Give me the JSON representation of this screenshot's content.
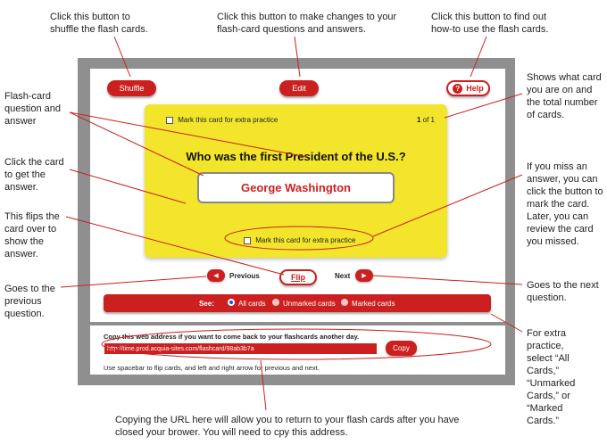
{
  "annotations": {
    "shuffle": "Click this button to shuffle the flash cards.",
    "edit": "Click this button to make changes to your flash-card questions and answers.",
    "help": "Click this button to find out how-to use the flash cards.",
    "card_count": "Shows what card you are on and the total number of cards.",
    "qa": "Flash-card question and answer",
    "click_card": "Click the card to get the answer.",
    "flip": "This flips the card over to show the answer.",
    "previous": "Goes to the previous question.",
    "mark": "If you miss an answer, you can click the button to mark the card. Later, you can review the card you missed.",
    "next": "Goes to the next question.",
    "filter": "For extra practice, select “All Cards,” “Unmarked Cards,” or “Marked Cards.”",
    "copy_url": "Copying the URL here will allow you to return to your flash cards after you have closed your brower. You will need to cpy this address."
  },
  "toolbar": {
    "shuffle_label": "Shuffle",
    "edit_label": "Edit",
    "help_label": "Help"
  },
  "card": {
    "mark_label": "Mark this card for extra practice",
    "counter_current": "1",
    "counter_total": "of 1",
    "question": "Who was the first President of the U.S.?",
    "answer": "George Washington",
    "mark_label_bottom": "Mark this card for extra practice"
  },
  "nav": {
    "previous_label": "Previous",
    "flip_label": "Flip",
    "next_label": "Next"
  },
  "filter": {
    "see_label": "See:",
    "options": [
      "All cards",
      "Unmarked cards",
      "Marked cards"
    ],
    "selected": "All cards"
  },
  "footer": {
    "copy_prompt": "Copy this web address if you want to come back to your flashcards another day.",
    "url": "http://time.prod.acquia-sites.com/flashcard/98ab3b7a",
    "copy_label": "Copy",
    "hint": "Use spacebar to flip cards, and left and right arrow for previous and next."
  },
  "colors": {
    "accent_red": "#cc1f1f",
    "card_yellow": "#f2e52c",
    "frame_gray": "#8f8f8f"
  }
}
